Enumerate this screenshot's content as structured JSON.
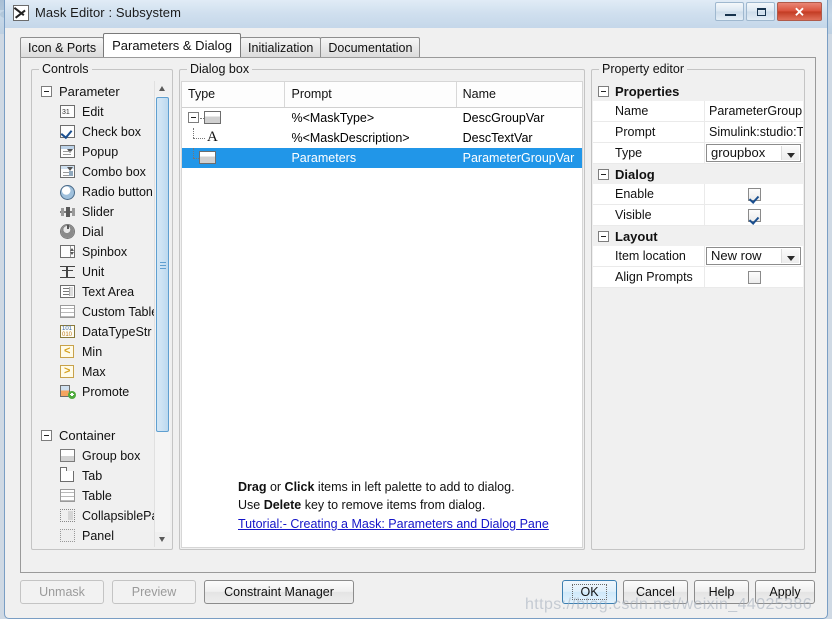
{
  "window": {
    "title": "Mask Editor : Subsystem",
    "icon": "mask-editor-icon",
    "minimize_label": "Minimize",
    "maximize_label": "Maximize",
    "close_label": "✕"
  },
  "tabs": [
    {
      "label": "Icon & Ports",
      "active": false
    },
    {
      "label": "Parameters & Dialog",
      "active": true
    },
    {
      "label": "Initialization",
      "active": false
    },
    {
      "label": "Documentation",
      "active": false
    }
  ],
  "controls_panel": {
    "title": "Controls",
    "groups": [
      {
        "name": "Parameter",
        "items": [
          {
            "label": "Edit",
            "icon": "edit-numeric-icon"
          },
          {
            "label": "Check box",
            "icon": "checkbox-icon"
          },
          {
            "label": "Popup",
            "icon": "popup-list-icon"
          },
          {
            "label": "Combo box",
            "icon": "combobox-icon"
          },
          {
            "label": "Radio button",
            "icon": "radio-button-icon"
          },
          {
            "label": "Slider",
            "icon": "slider-icon"
          },
          {
            "label": "Dial",
            "icon": "dial-icon"
          },
          {
            "label": "Spinbox",
            "icon": "spinbox-icon"
          },
          {
            "label": "Unit",
            "icon": "unit-icon"
          },
          {
            "label": "Text Area",
            "icon": "text-area-icon"
          },
          {
            "label": "Custom Table",
            "icon": "custom-table-icon"
          },
          {
            "label": "DataTypeStr",
            "icon": "datatypestr-icon"
          },
          {
            "label": "Min",
            "icon": "min-icon"
          },
          {
            "label": "Max",
            "icon": "max-icon"
          },
          {
            "label": "Promote",
            "icon": "promote-icon"
          }
        ]
      },
      {
        "name": "Container",
        "items": [
          {
            "label": "Group box",
            "icon": "group-box-icon"
          },
          {
            "label": "Tab",
            "icon": "tab-icon"
          },
          {
            "label": "Table",
            "icon": "table-icon"
          },
          {
            "label": "CollapsiblePar",
            "icon": "collapsible-panel-icon"
          },
          {
            "label": "Panel",
            "icon": "panel-icon"
          }
        ]
      }
    ]
  },
  "dialog_box": {
    "title": "Dialog box",
    "columns": [
      "Type",
      "Prompt",
      "Name"
    ],
    "rows": [
      {
        "icon": "group-box-icon",
        "depth": 0,
        "expandable": true,
        "type": "",
        "prompt": "%<MaskType>",
        "name": "DescGroupVar",
        "selected": false
      },
      {
        "icon": "text-label-icon",
        "depth": 1,
        "expandable": false,
        "type": "",
        "prompt": "%<MaskDescription>",
        "name": "DescTextVar",
        "selected": false
      },
      {
        "icon": "group-box-icon",
        "depth": 1,
        "expandable": false,
        "type": "",
        "prompt": "Parameters",
        "name": "ParameterGroupVar",
        "selected": true
      }
    ],
    "help_line1_a": "Drag",
    "help_line1_b": " or ",
    "help_line1_c": "Click",
    "help_line1_d": " items in left palette to add to dialog.",
    "help_line2_a": "Use ",
    "help_line2_b": "Delete",
    "help_line2_c": " key to remove items from dialog.",
    "tutorial_link": "Tutorial:- Creating a Mask: Parameters and Dialog Pane"
  },
  "property_editor": {
    "title": "Property editor",
    "sections": [
      {
        "name": "Properties",
        "rows": [
          {
            "label": "Name",
            "value": "ParameterGroup...",
            "kind": "text"
          },
          {
            "label": "Prompt",
            "value": "Simulink:studio:T...",
            "kind": "text"
          },
          {
            "label": "Type",
            "value": "groupbox",
            "kind": "combo"
          }
        ]
      },
      {
        "name": "Dialog",
        "rows": [
          {
            "label": "Enable",
            "value": "checked",
            "kind": "checkbox"
          },
          {
            "label": "Visible",
            "value": "checked",
            "kind": "checkbox"
          }
        ]
      },
      {
        "name": "Layout",
        "rows": [
          {
            "label": "Item location",
            "value": "New row",
            "kind": "combo"
          },
          {
            "label": "Align Prompts",
            "value": "unchecked",
            "kind": "checkbox"
          }
        ]
      }
    ]
  },
  "buttons": {
    "unmask": "Unmask",
    "preview": "Preview",
    "constraint_manager": "Constraint Manager",
    "ok": "OK",
    "cancel": "Cancel",
    "help": "Help",
    "apply": "Apply"
  },
  "watermark": "https://blog.csdn.net/weixin_44025386",
  "colors": {
    "selection": "#2196e8",
    "link": "#1414c8",
    "titlebar": "#c5dbee",
    "panel": "#f0f0f0",
    "close_button": "#d9503a"
  }
}
